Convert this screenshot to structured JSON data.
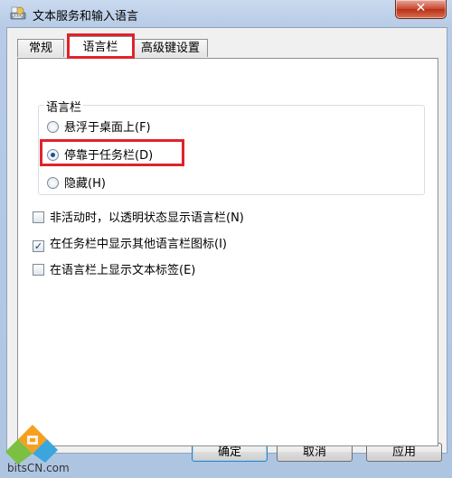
{
  "window": {
    "title": "文本服务和输入语言",
    "close_glyph": "✕"
  },
  "tabs": [
    {
      "label": "常规",
      "active": false
    },
    {
      "label": "语言栏",
      "active": true
    },
    {
      "label": "高级键设置",
      "active": false
    }
  ],
  "language_bar_group": {
    "title": "语言栏",
    "options": [
      {
        "label": "悬浮于桌面上(F)",
        "selected": false
      },
      {
        "label": "停靠于任务栏(D)",
        "selected": true
      },
      {
        "label": "隐藏(H)",
        "selected": false
      }
    ]
  },
  "checkboxes": [
    {
      "label": "非活动时，以透明状态显示语言栏(N)",
      "checked": false
    },
    {
      "label": "在任务栏中显示其他语言栏图标(I)",
      "checked": true
    },
    {
      "label": "在语言栏上显示文本标签(E)",
      "checked": false
    }
  ],
  "buttons": {
    "ok": "确定",
    "cancel": "取消",
    "apply": "应用"
  },
  "watermark": {
    "text": "bitsCN.com"
  },
  "colors": {
    "highlight_red": "#e0232b",
    "title_gradient": "#b7cbe6",
    "close_red": "#c7462f"
  }
}
